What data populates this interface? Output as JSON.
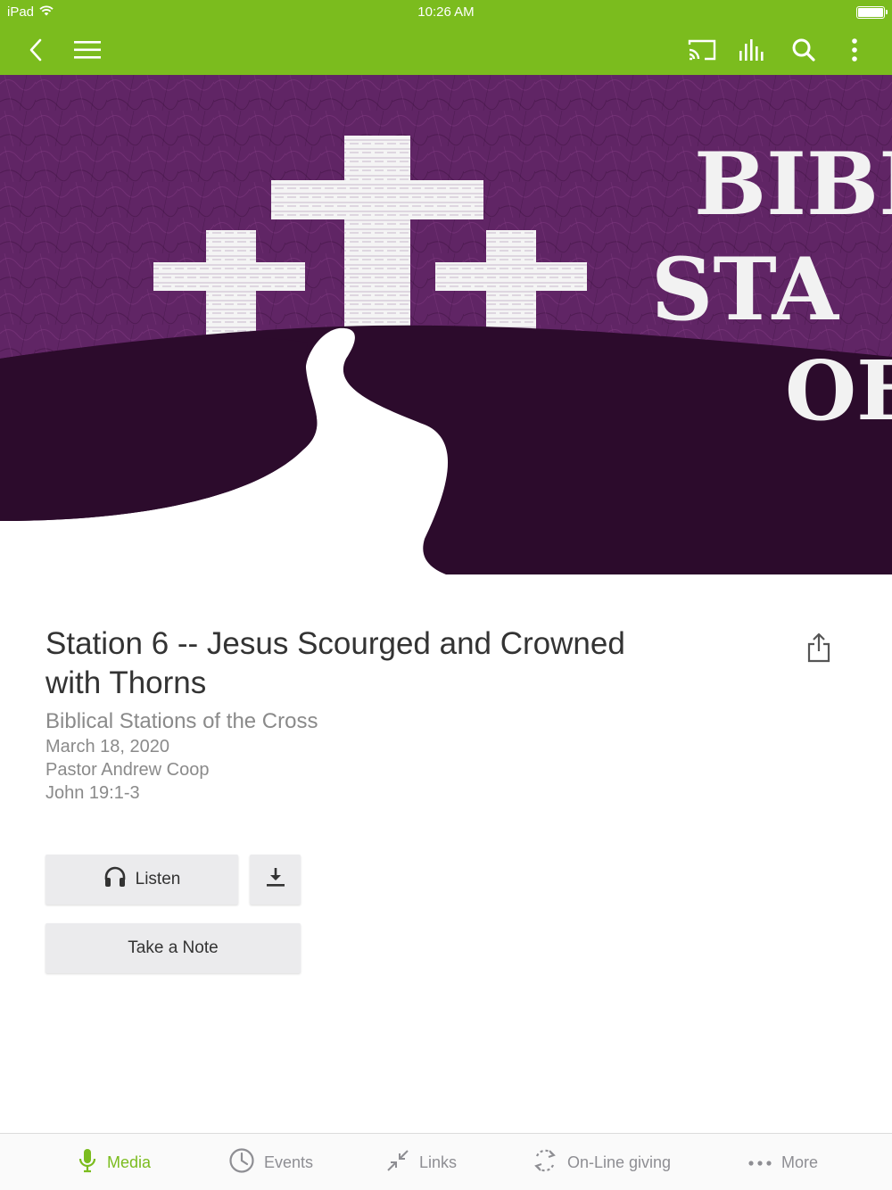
{
  "status_bar": {
    "device": "iPad",
    "time": "10:26 AM"
  },
  "nav_bar": {
    "accent_color": "#7bbc1e",
    "icons": [
      "back-chevron-icon",
      "menu-icon",
      "cast-icon",
      "audio-levels-icon",
      "search-icon",
      "more-vertical-icon"
    ]
  },
  "hero": {
    "artwork_text": [
      "BIBL",
      "STA",
      "OF"
    ],
    "colors": {
      "sky": "#6a2a6e",
      "hill": "#2c0b2c",
      "path": "#ffffff"
    }
  },
  "sermon": {
    "title": "Station 6 -- Jesus Scourged and Crowned with Thorns",
    "series": "Biblical Stations of the Cross",
    "date": "March 18, 2020",
    "speaker": "Pastor Andrew Coop",
    "scripture": "John 19:1-3"
  },
  "actions": {
    "listen_label": "Listen",
    "download_icon": "download-icon",
    "note_label": "Take a Note",
    "share_icon": "share-icon"
  },
  "tab_bar": {
    "tabs": [
      {
        "label": "Media",
        "icon": "microphone-icon",
        "active": true
      },
      {
        "label": "Events",
        "icon": "clock-icon",
        "active": false
      },
      {
        "label": "Links",
        "icon": "shrink-arrows-icon",
        "active": false
      },
      {
        "label": "On-Line giving",
        "icon": "sync-icon",
        "active": false
      },
      {
        "label": "More",
        "icon": "ellipsis-icon",
        "active": false
      }
    ]
  }
}
